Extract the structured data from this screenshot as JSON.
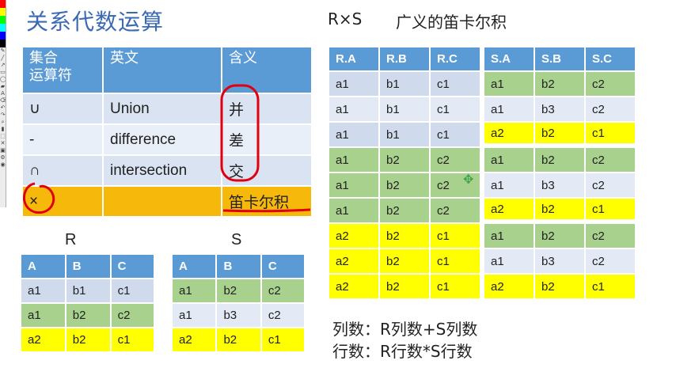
{
  "title": "关系代数运算",
  "product_heading": "R×S",
  "product_caption": "广义的笛卡尔积",
  "ops_table": {
    "headers": [
      "集合\n运算符",
      "英文",
      "含义"
    ],
    "rows": [
      [
        "∪",
        "Union",
        "并"
      ],
      [
        "-",
        "difference",
        "差"
      ],
      [
        "∩",
        "intersection",
        "交"
      ],
      [
        "×",
        "",
        "笛卡尔积"
      ]
    ]
  },
  "r_label": "R",
  "s_label": "S",
  "r_table": {
    "headers": [
      "A",
      "B",
      "C"
    ],
    "rows": [
      [
        "a1",
        "b1",
        "c1"
      ],
      [
        "a1",
        "b2",
        "c2"
      ],
      [
        "a2",
        "b2",
        "c1"
      ]
    ]
  },
  "s_table": {
    "headers": [
      "A",
      "B",
      "C"
    ],
    "rows": [
      [
        "a1",
        "b2",
        "c2"
      ],
      [
        "a1",
        "b3",
        "c2"
      ],
      [
        "a2",
        "b2",
        "c1"
      ]
    ]
  },
  "product_left": {
    "headers": [
      "R.A",
      "R.B",
      "R.C"
    ],
    "rows": [
      [
        "a1",
        "b1",
        "c1"
      ],
      [
        "a1",
        "b1",
        "c1"
      ],
      [
        "a1",
        "b1",
        "c1"
      ],
      [
        "a1",
        "b2",
        "c2"
      ],
      [
        "a1",
        "b2",
        "c2"
      ],
      [
        "a1",
        "b2",
        "c2"
      ],
      [
        "a2",
        "b2",
        "c1"
      ],
      [
        "a2",
        "b2",
        "c1"
      ],
      [
        "a2",
        "b2",
        "c1"
      ]
    ]
  },
  "product_right": {
    "headers": [
      "S.A",
      "S.B",
      "S.C"
    ],
    "rows": [
      [
        "a1",
        "b2",
        "c2"
      ],
      [
        "a1",
        "b3",
        "c2"
      ],
      [
        "a2",
        "b2",
        "c1"
      ],
      [
        "a1",
        "b2",
        "c2"
      ],
      [
        "a1",
        "b3",
        "c2"
      ],
      [
        "a2",
        "b2",
        "c1"
      ],
      [
        "a1",
        "b2",
        "c2"
      ],
      [
        "a1",
        "b3",
        "c2"
      ],
      [
        "a2",
        "b2",
        "c1"
      ]
    ]
  },
  "formula_cols": "列数：R列数+S列数",
  "formula_rows": "行数：R行数*S行数",
  "colors": {
    "header_blue": "#5b9bd5",
    "row_blue": "#cfdbec",
    "row_green": "#a9d18e",
    "row_yellow": "#ffff00",
    "row_gold": "#f5b80b",
    "annotation_red": "#e0000f",
    "title_blue": "#3a6ab5"
  },
  "icons": [
    "move-cursor-icon"
  ]
}
